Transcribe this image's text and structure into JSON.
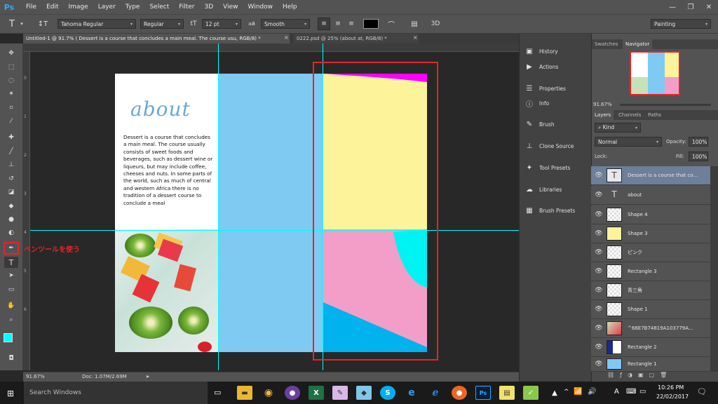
{
  "app": {
    "logo": "Ps"
  },
  "menu": [
    "File",
    "Edit",
    "Image",
    "Layer",
    "Type",
    "Select",
    "Filter",
    "3D",
    "View",
    "Window",
    "Help"
  ],
  "options": {
    "font_family": "Tahoma Regular",
    "font_style": "Regular",
    "font_size": "12 pt",
    "aa_label": "a",
    "aa_mode": "Smooth",
    "tool_3d": "3D",
    "workspace": "Painting"
  },
  "tabs": [
    {
      "label": "Untitled-1 @ 91.7% ( Dessert is a course that concludes a main meal. The course usu, RGB/8) *"
    },
    {
      "label": "0222.psd @ 25% (about at, RGB/8) *"
    }
  ],
  "document": {
    "heading": "about",
    "body": "Dessert is a course that concludes a main meal. The course usually consists of sweet foods and beverages, such as dessert wine or liqueurs, but may include coffee, cheeses and nuts. In some parts of the world, such as much of central and western Africa there is no tradition of a dessert course to conclude a meal"
  },
  "annotation": "ペンツールを使う",
  "status": {
    "zoom": "91.67%",
    "doc": "Doc: 1.07M/2.69M"
  },
  "ruler_left": [
    "0",
    "1",
    "2",
    "3",
    "4",
    "5",
    "6"
  ],
  "dock": [
    "History",
    "Actions",
    "Properties",
    "Info",
    "Brush",
    "Clone Source",
    "Tool Presets",
    "Libraries",
    "Brush Presets"
  ],
  "navigator": {
    "tabs": [
      "Swatches",
      "Navigator"
    ],
    "zoom": "91.67%"
  },
  "layers_panel": {
    "tabs": [
      "Layers",
      "Channels",
      "Paths"
    ],
    "kind": "Kind",
    "blend": "Normal",
    "opacity_label": "Opacity:",
    "opacity": "100%",
    "lock_label": "Lock:",
    "fill_label": "Fill:",
    "fill": "100%",
    "layers": [
      {
        "name": "Dessert is a course that co...",
        "type": "text",
        "selected": true
      },
      {
        "name": "about",
        "type": "text"
      },
      {
        "name": "Shape 4",
        "type": "shape"
      },
      {
        "name": "Shape 3",
        "type": "shape"
      },
      {
        "name": "ピンク",
        "type": "shape"
      },
      {
        "name": "Rectangle 3",
        "type": "shape"
      },
      {
        "name": "青三角",
        "type": "shape"
      },
      {
        "name": "Shape 1",
        "type": "shape"
      },
      {
        "name": "^66E7B74819A103779A...",
        "type": "image"
      },
      {
        "name": "Rectangle 2",
        "type": "shape"
      },
      {
        "name": "Rectangle 1",
        "type": "shape"
      }
    ]
  },
  "taskbar": {
    "search": "Search Windows",
    "time": "10:26 PM",
    "date": "22/02/2017",
    "lang": "A"
  },
  "colors": {
    "accent": "#31a8ff",
    "guide": "#00ffff",
    "highlight": "#e8232a"
  }
}
